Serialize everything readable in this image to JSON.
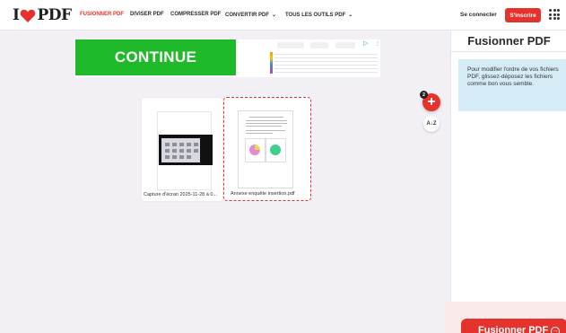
{
  "header": {
    "logo_left": "I",
    "logo_right": "PDF",
    "nav": [
      {
        "label": "FUSIONNER PDF",
        "active": true
      },
      {
        "label": "DIVISER PDF"
      },
      {
        "label": "COMPRESSER PDF"
      },
      {
        "label": "CONVERTIR PDF",
        "dropdown": true
      },
      {
        "label": "TOUS LES OUTILS PDF",
        "dropdown": true
      }
    ],
    "login": "Se connecter",
    "signup": "S'inscrire",
    "brand_color": "#e5322d"
  },
  "ad": {
    "button_label": "CONTINUE",
    "button_color": "#1fba2a"
  },
  "files": [
    {
      "name": "Capture d'écran 2025-11-28 à 0..."
    },
    {
      "name": "Annexe enquête insertion.pdf"
    }
  ],
  "toolbar": {
    "add_label": "+",
    "file_count": "2",
    "sort_label": "A↓Z"
  },
  "sidebar": {
    "title": "Fusionner PDF",
    "info": "Pour modifier l'ordre de vos fichiers PDF, glissez-déposez les fichiers comme bon vous semble.",
    "merge_button": "Fusionner PDF",
    "merge_arrow": "→"
  }
}
